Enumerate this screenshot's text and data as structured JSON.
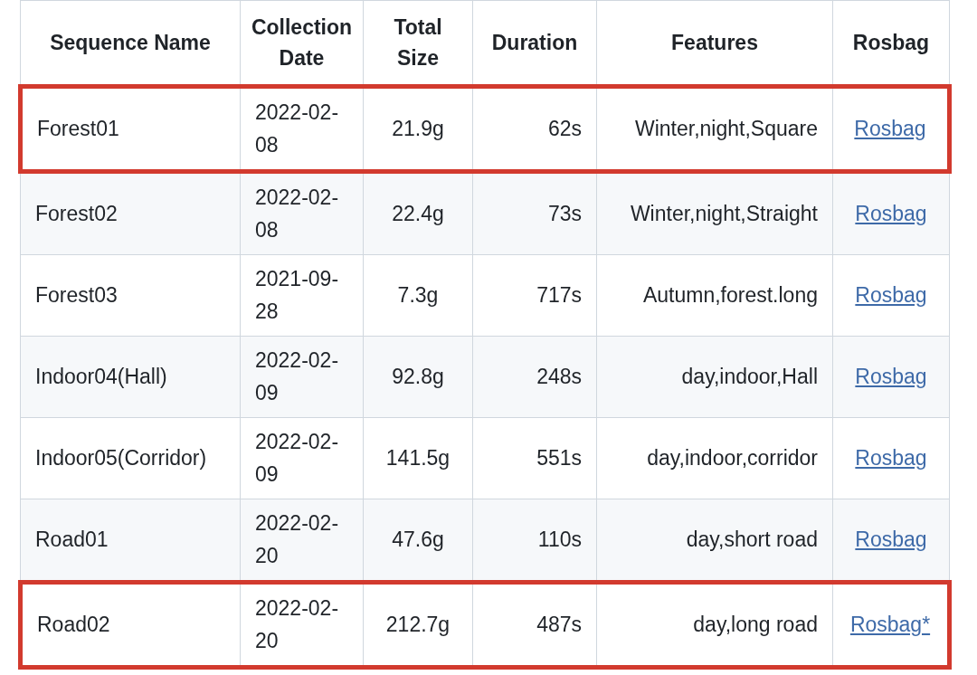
{
  "table": {
    "columns": [
      "Sequence Name",
      "Collection Date",
      "Total Size",
      "Duration",
      "Features",
      "Rosbag"
    ],
    "rows": [
      {
        "name": "Forest01",
        "date": "2022-02-08",
        "size": "21.9g",
        "duration": "62s",
        "features": "Winter,night,Square",
        "rosbag": "Rosbag",
        "highlighted": true
      },
      {
        "name": "Forest02",
        "date": "2022-02-08",
        "size": "22.4g",
        "duration": "73s",
        "features": "Winter,night,Straight",
        "rosbag": "Rosbag",
        "highlighted": false
      },
      {
        "name": "Forest03",
        "date": "2021-09-28",
        "size": "7.3g",
        "duration": "717s",
        "features": "Autumn,forest.long",
        "rosbag": "Rosbag",
        "highlighted": false
      },
      {
        "name": "Indoor04(Hall)",
        "date": "2022-02-09",
        "size": "92.8g",
        "duration": "248s",
        "features": "day,indoor,Hall",
        "rosbag": "Rosbag",
        "highlighted": false
      },
      {
        "name": "Indoor05(Corridor)",
        "date": "2022-02-09",
        "size": "141.5g",
        "duration": "551s",
        "features": "day,indoor,corridor",
        "rosbag": "Rosbag",
        "highlighted": false
      },
      {
        "name": "Road01",
        "date": "2022-02-20",
        "size": "47.6g",
        "duration": "110s",
        "features": "day,short road",
        "rosbag": "Rosbag",
        "highlighted": false
      },
      {
        "name": "Road02",
        "date": "2022-02-20",
        "size": "212.7g",
        "duration": "487s",
        "features": "day,long road",
        "rosbag": "Rosbag*",
        "highlighted": true
      }
    ]
  }
}
